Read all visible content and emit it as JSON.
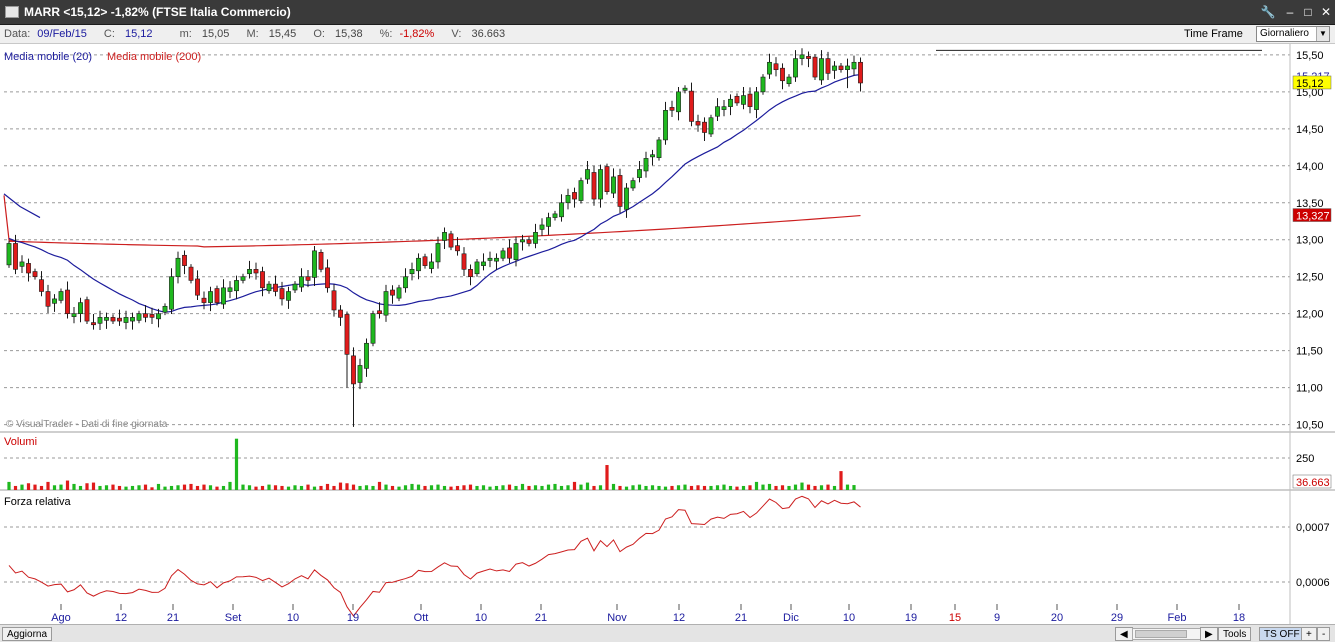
{
  "window": {
    "title": "MARR <15,12> -1,82%  (FTSE Italia Commercio)"
  },
  "info_bar": {
    "date_label": "Data:",
    "date_value": "09/Feb/15",
    "close_label": "C:",
    "close_value": "15,12",
    "min_label": "m:",
    "min_value": "15,05",
    "max_label": "M:",
    "max_value": "15,45",
    "open_label": "O:",
    "open_value": "15,38",
    "pct_label": "%:",
    "pct_value": "-1,82%",
    "vol_label": "V:",
    "vol_value": "36.663",
    "time_frame_label": "Time Frame",
    "time_frame_value": "Giornaliero"
  },
  "status_bar": {
    "refresh_label": "Aggiorna",
    "tools_label": "Tools",
    "ts_label": "TS OFF"
  },
  "colors": {
    "up": "#1fb81f",
    "down": "#e01b1b",
    "ma20": "#1c1c9c",
    "ma200": "#cc1f1f",
    "rs": "#cc1f1f",
    "price_tag": "#ffff00",
    "ma200_tag": "#cc0000",
    "vol_tag": "#cc0000"
  },
  "chart_data": [
    {
      "type": "candlestick",
      "panel": "price",
      "legend": [
        "Media mobile (20)",
        "Media mobile (200)"
      ],
      "watermark": "© VisualTrader - Dati di fine giornata",
      "ylim": [
        10.4,
        15.62
      ],
      "y_ticks": [
        "15,50",
        "15,00",
        "14,50",
        "14,00",
        "13,50",
        "13,00",
        "12,50",
        "12,00",
        "11,50",
        "11,00",
        "10,50"
      ],
      "current_price_tag": "15,12",
      "ma20_tag": "15,217",
      "ma200_tag": "13,327",
      "resistance_level": 15.56,
      "x_ticks": [
        "Ago",
        "12",
        "21",
        "Set",
        "10",
        "19",
        "Ott",
        "10",
        "21",
        "Nov",
        "12",
        "21",
        "Dic",
        "10",
        "19",
        "15",
        "9",
        "20",
        "29",
        "Feb",
        "18"
      ],
      "highlighted_x_tick": "15",
      "close": [
        12.95,
        12.6,
        12.7,
        12.55,
        12.5,
        12.3,
        12.1,
        12.2,
        12.3,
        12.0,
        12.0,
        12.15,
        11.9,
        11.85,
        11.95,
        11.95,
        11.9,
        11.9,
        11.95,
        11.95,
        12.0,
        11.95,
        11.95,
        12.0,
        12.1,
        12.5,
        12.75,
        12.65,
        12.45,
        12.25,
        12.15,
        12.3,
        12.15,
        12.35,
        12.35,
        12.45,
        12.5,
        12.6,
        12.55,
        12.35,
        12.4,
        12.3,
        12.2,
        12.3,
        12.4,
        12.5,
        12.45,
        12.85,
        12.6,
        12.35,
        12.05,
        11.95,
        11.45,
        11.05,
        11.3,
        11.6,
        12.0,
        12.0,
        12.3,
        12.25,
        12.35,
        12.5,
        12.6,
        12.75,
        12.65,
        12.7,
        12.95,
        13.1,
        12.9,
        12.85,
        12.6,
        12.5,
        12.7,
        12.7,
        12.75,
        12.75,
        12.85,
        12.75,
        12.95,
        13.0,
        12.95,
        13.1,
        13.2,
        13.3,
        13.35,
        13.5,
        13.6,
        13.55,
        13.8,
        13.95,
        13.55,
        13.95,
        13.65,
        13.85,
        13.45,
        13.7,
        13.8,
        13.95,
        14.1,
        14.15,
        14.35,
        14.75,
        14.75,
        15.0,
        15.05,
        14.6,
        14.55,
        14.45,
        14.65,
        14.8,
        14.8,
        14.9,
        14.85,
        14.95,
        14.8,
        15.0,
        15.2,
        15.4,
        15.3,
        15.15,
        15.2,
        15.45,
        15.5,
        15.45,
        15.2,
        15.45,
        15.25,
        15.35,
        15.3,
        15.35,
        15.4,
        15.12
      ]
    },
    {
      "type": "bar",
      "panel": "volume",
      "title": "Volumi",
      "y_ticks": [
        "250"
      ],
      "ylim": [
        0,
        400
      ],
      "last_value_tag": "36.663",
      "values": [
        60,
        30,
        40,
        50,
        40,
        30,
        60,
        35,
        40,
        70,
        45,
        30,
        50,
        55,
        30,
        35,
        40,
        30,
        25,
        30,
        35,
        40,
        20,
        45,
        25,
        30,
        35,
        40,
        45,
        30,
        40,
        35,
        25,
        30,
        60,
        45,
        40,
        35,
        25,
        30,
        40,
        35,
        30,
        25,
        35,
        30,
        40,
        25,
        30,
        45,
        30,
        55,
        50,
        40,
        30,
        35,
        30,
        60,
        40,
        30,
        25,
        35,
        45,
        40,
        30,
        35,
        40,
        30,
        25,
        30,
        35,
        40,
        30,
        35,
        25,
        30,
        35,
        40,
        30,
        45,
        30,
        35,
        30,
        40,
        45,
        30,
        35,
        60,
        40,
        55,
        30,
        35,
        30,
        45,
        30,
        25,
        35,
        40,
        30,
        35,
        30,
        25,
        30,
        35,
        40,
        30,
        35,
        30,
        30,
        35,
        40,
        30,
        25,
        30,
        35,
        60,
        40,
        45,
        30,
        35,
        30,
        40,
        55,
        40,
        30,
        35,
        40,
        30,
        35,
        40,
        36.663
      ]
    },
    {
      "type": "line",
      "panel": "relative_strength",
      "title": "Forza relativa",
      "y_ticks": [
        "0,0007",
        "0,0006"
      ],
      "ylim": [
        0.00052,
        0.00078
      ]
    }
  ]
}
